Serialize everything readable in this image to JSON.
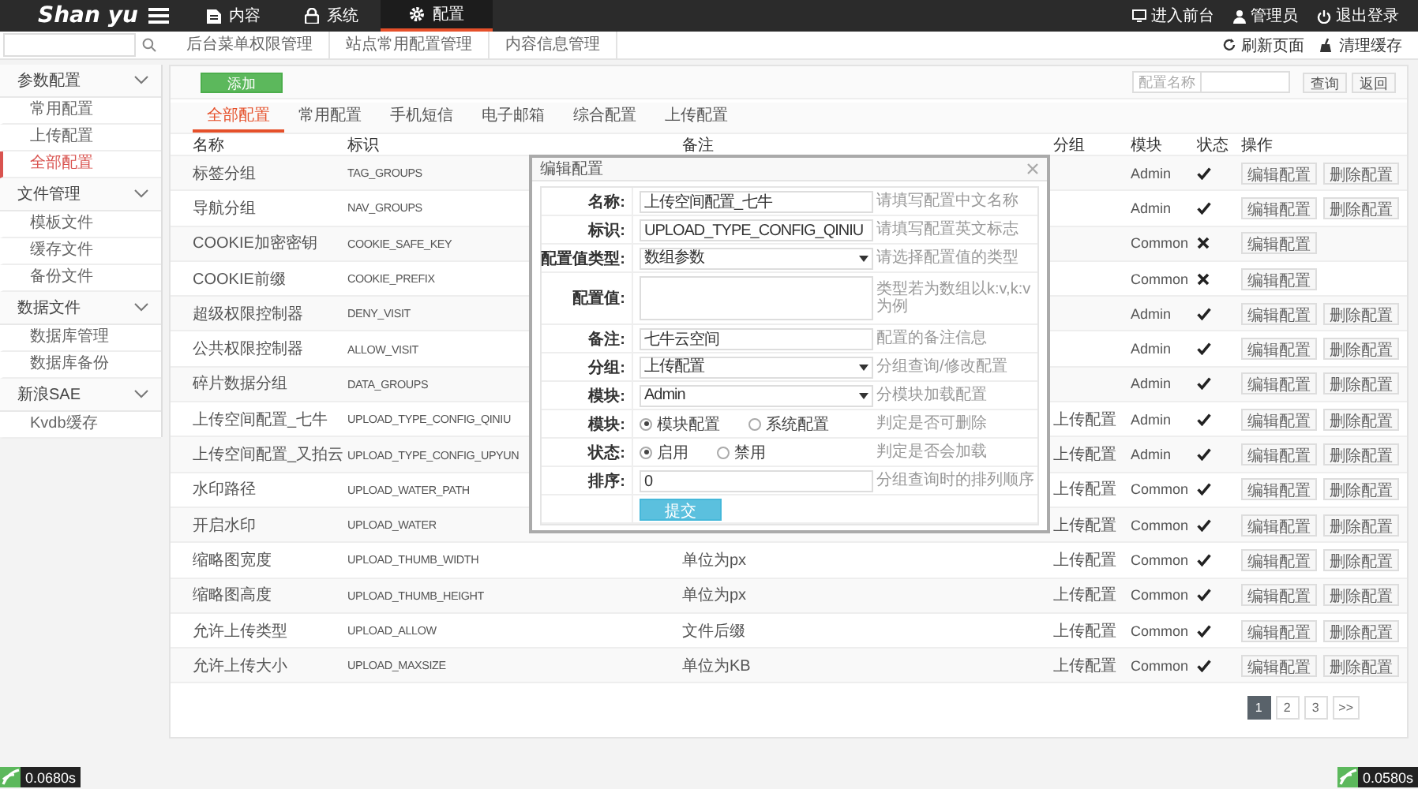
{
  "topbar": {
    "logo": "Shan yu",
    "nav": [
      {
        "label": "内容",
        "selected": false
      },
      {
        "label": "系统",
        "selected": false
      },
      {
        "label": "配置",
        "selected": true
      }
    ],
    "actions": [
      "进入前台",
      "管理员",
      "退出登录"
    ]
  },
  "subbar": {
    "tabs": [
      "后台菜单权限管理",
      "站点常用配置管理",
      "内容信息管理"
    ],
    "actions": [
      "刷新页面",
      "清理缓存"
    ]
  },
  "sidebar": {
    "groups": [
      {
        "label": "参数配置",
        "expanded": true,
        "children": [
          {
            "label": "常用配置",
            "selected": false
          },
          {
            "label": "上传配置",
            "selected": false
          },
          {
            "label": "全部配置",
            "selected": true
          }
        ]
      },
      {
        "label": "文件管理",
        "expanded": true,
        "children": [
          {
            "label": "模板文件",
            "selected": false
          },
          {
            "label": "缓存文件",
            "selected": false
          },
          {
            "label": "备份文件",
            "selected": false
          }
        ]
      },
      {
        "label": "数据文件",
        "expanded": true,
        "children": [
          {
            "label": "数据库管理",
            "selected": false
          },
          {
            "label": "数据库备份",
            "selected": false
          }
        ]
      },
      {
        "label": "新浪SAE",
        "expanded": true,
        "children": [
          {
            "label": "Kvdb缓存",
            "selected": false
          }
        ]
      }
    ]
  },
  "toolbar": {
    "add_button": "添加",
    "search_label": "配置名称",
    "buttons": [
      "查询",
      "返回"
    ]
  },
  "tabs": [
    {
      "label": "全部配置",
      "selected": true
    },
    {
      "label": "常用配置",
      "selected": false
    },
    {
      "label": "手机短信",
      "selected": false
    },
    {
      "label": "电子邮箱",
      "selected": false
    },
    {
      "label": "综合配置",
      "selected": false
    },
    {
      "label": "上传配置",
      "selected": false
    }
  ],
  "table": {
    "columns": [
      "名称",
      "标识",
      "备注",
      "分组",
      "模块",
      "状态",
      "操作"
    ],
    "rows": [
      {
        "name": "标签分组",
        "key": "TAG_GROUPS",
        "module": "Admin",
        "enabled": true,
        "actions": [
          "编辑配置",
          "删除配置"
        ]
      },
      {
        "name": "导航分组",
        "key": "NAV_GROUPS",
        "module": "Admin",
        "enabled": true,
        "actions": [
          "编辑配置",
          "删除配置"
        ]
      },
      {
        "name": "COOKIE加密密钥",
        "key": "COOKIE_SAFE_KEY",
        "module": "Common",
        "enabled": false,
        "actions": [
          "编辑配置"
        ]
      },
      {
        "name": "COOKIE前缀",
        "key": "COOKIE_PREFIX",
        "module": "Common",
        "enabled": false,
        "actions": [
          "编辑配置"
        ]
      },
      {
        "name": "超级权限控制器",
        "key": "DENY_VISIT",
        "module": "Admin",
        "enabled": true,
        "actions": [
          "编辑配置",
          "删除配置"
        ]
      },
      {
        "name": "公共权限控制器",
        "key": "ALLOW_VISIT",
        "module": "Admin",
        "enabled": true,
        "actions": [
          "编辑配置",
          "删除配置"
        ]
      },
      {
        "name": "碎片数据分组",
        "key": "DATA_GROUPS",
        "module": "Admin",
        "enabled": true,
        "actions": [
          "编辑配置",
          "删除配置"
        ]
      },
      {
        "name": "上传空间配置_七牛",
        "key": "UPLOAD_TYPE_CONFIG_QINIU",
        "group": "上传配置",
        "module": "Admin",
        "enabled": true,
        "actions": [
          "编辑配置",
          "删除配置"
        ]
      },
      {
        "name": "上传空间配置_又拍云",
        "key": "UPLOAD_TYPE_CONFIG_UPYUN",
        "group": "上传配置",
        "module": "Admin",
        "enabled": true,
        "actions": [
          "编辑配置",
          "删除配置"
        ]
      },
      {
        "name": "水印路径",
        "key": "UPLOAD_WATER_PATH",
        "group": "上传配置",
        "module": "Common",
        "enabled": true,
        "actions": [
          "编辑配置",
          "删除配置"
        ]
      },
      {
        "name": "开启水印",
        "key": "UPLOAD_WATER",
        "group": "上传配置",
        "module": "Common",
        "enabled": true,
        "actions": [
          "编辑配置",
          "删除配置"
        ]
      },
      {
        "name": "缩略图宽度",
        "key": "UPLOAD_THUMB_WIDTH",
        "remark": "单位为px",
        "group": "上传配置",
        "module": "Common",
        "enabled": true,
        "actions": [
          "编辑配置",
          "删除配置"
        ]
      },
      {
        "name": "缩略图高度",
        "key": "UPLOAD_THUMB_HEIGHT",
        "remark": "单位为px",
        "group": "上传配置",
        "module": "Common",
        "enabled": true,
        "actions": [
          "编辑配置",
          "删除配置"
        ]
      },
      {
        "name": "允许上传类型",
        "key": "UPLOAD_ALLOW",
        "remark": "文件后缀",
        "group": "上传配置",
        "module": "Common",
        "enabled": true,
        "actions": [
          "编辑配置",
          "删除配置"
        ]
      },
      {
        "name": "允许上传大小",
        "key": "UPLOAD_MAXSIZE",
        "remark": "单位为KB",
        "group": "上传配置",
        "module": "Common",
        "enabled": true,
        "actions": [
          "编辑配置",
          "删除配置"
        ]
      }
    ]
  },
  "pagination": [
    {
      "label": "1",
      "selected": true
    },
    {
      "label": "2",
      "selected": false
    },
    {
      "label": "3",
      "selected": false
    },
    {
      "label": ">>",
      "selected": false
    }
  ],
  "modal": {
    "title": "编辑配置",
    "fields": [
      {
        "kind": "input",
        "label": "名称:",
        "value": "上传空间配置_七牛",
        "hint": "请填写配置中文名称"
      },
      {
        "kind": "input",
        "label": "标识:",
        "value": "UPLOAD_TYPE_CONFIG_QINIU",
        "hint": "请填写配置英文标志"
      },
      {
        "kind": "select",
        "label": "配置值类型:",
        "value": "数组参数",
        "hint": "请选择配置值的类型"
      },
      {
        "kind": "textarea",
        "label": "配置值:",
        "hint": "类型若为数组以k:v,k:v为例"
      },
      {
        "kind": "input",
        "label": "备注:",
        "value": "七牛云空间",
        "hint": "配置的备注信息"
      },
      {
        "kind": "select",
        "label": "分组:",
        "value": "上传配置",
        "hint": "分组查询/修改配置"
      },
      {
        "kind": "select",
        "label": "模块:",
        "value": "Admin",
        "hint": "分模块加载配置"
      },
      {
        "kind": "radio",
        "label": "模块:",
        "options": [
          {
            "label": "模块配置",
            "selected": true
          },
          {
            "label": "系统配置",
            "selected": false
          }
        ],
        "hint": "判定是否可删除"
      },
      {
        "kind": "radio",
        "label": "状态:",
        "options": [
          {
            "label": "启用",
            "selected": true
          },
          {
            "label": "禁用",
            "selected": false
          }
        ],
        "hint": "判定是否会加载"
      },
      {
        "kind": "input",
        "label": "排序:",
        "value": "0",
        "hint": "分组查询时的排列顺序"
      }
    ],
    "submit": "提交"
  },
  "debug_badges": [
    "0.0680s",
    "0.0580s"
  ]
}
